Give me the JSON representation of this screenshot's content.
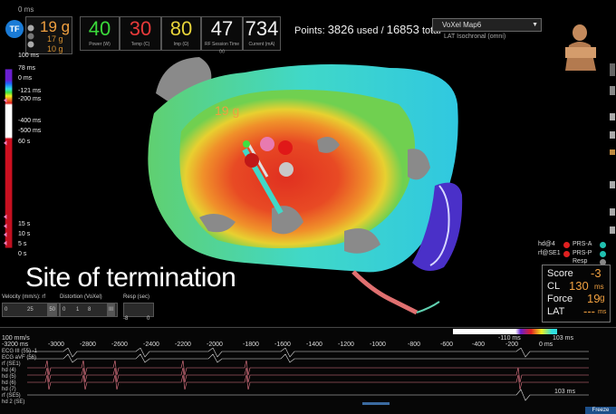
{
  "force_display": {
    "badge": "TF",
    "small": "0 ms",
    "main": "19 g",
    "sub1": "17 g",
    "sub2": "10 g"
  },
  "metrics": [
    {
      "value": "40",
      "label": "Power (W)",
      "color": "#3ad93a"
    },
    {
      "value": "30",
      "label": "Temp (C)",
      "color": "#e83a3a"
    },
    {
      "value": "80",
      "label": "Imp (Ω)",
      "color": "#e8d43a"
    },
    {
      "value": "47",
      "label": "RF Session Time (s)",
      "color": "#f2f2f2"
    },
    {
      "value": "734",
      "label": "Current (mA)",
      "color": "#f2f2f2"
    }
  ],
  "points": {
    "prefix": "Points:",
    "used": "3826",
    "used_label": "used /",
    "total": "16853",
    "total_label": "total"
  },
  "map_select": {
    "value": "VoXel Map6",
    "sub": "LAT Isochronal (omni)"
  },
  "scale_ticks": [
    "100 ms",
    "78 ms",
    "0 ms",
    "-121 ms",
    "-200 ms",
    "-400 ms",
    "-500 ms",
    "60 s",
    "15 s",
    "10 s",
    "5 s",
    "0 s"
  ],
  "caption": "Site of termination",
  "annotation": "19 g",
  "legend": [
    {
      "label": "hd@4",
      "color": "#e02020"
    },
    {
      "label": "PRS-A",
      "color": "#20c0b0"
    },
    {
      "label": "rf@SE1",
      "color": "#e02020"
    },
    {
      "label": "PRS-P",
      "color": "#20c0b0"
    },
    {
      "label": "Resp",
      "color": "#888888"
    }
  ],
  "score_box": {
    "score_label": "Score",
    "score": "-3",
    "cl_label": "CL",
    "cl": "130",
    "cl_unit": "ms",
    "force_label": "Force",
    "force": "19",
    "force_unit": "g",
    "lat_label": "LAT",
    "lat": "---",
    "lat_unit": "ms"
  },
  "controls": {
    "velocity_label": "Velocity (mm/s): rf",
    "velocity_values": [
      "0",
      "25",
      "50"
    ],
    "distortion_label": "Distortion (VoXel)",
    "distortion_values": [
      "0",
      "1",
      "8",
      "III"
    ],
    "resp_label": "Resp (sec)",
    "resp_values": [
      "-8",
      "0"
    ]
  },
  "timeline": {
    "speed": "100 mm/s",
    "ticks": [
      "-3200 ms",
      "-3000",
      "-2800",
      "-2600",
      "-2400",
      "-2200",
      "-2000",
      "-1800",
      "-1600",
      "-1400",
      "-1200",
      "-1000",
      "-800",
      "-600",
      "-400",
      "-200",
      "0 ms"
    ],
    "marker1": "-110 ms",
    "marker2": "103 ms",
    "marker3": "103 ms",
    "channels": [
      "ECG III (55) -1",
      "ECG aVF (56)",
      "rf (SE1)",
      "hd (4)",
      "hd (5)",
      "hd (6)",
      "hd (7)",
      "rf (SE5)",
      "hd 2 (SE)"
    ],
    "freeze_label": "Freeze"
  }
}
